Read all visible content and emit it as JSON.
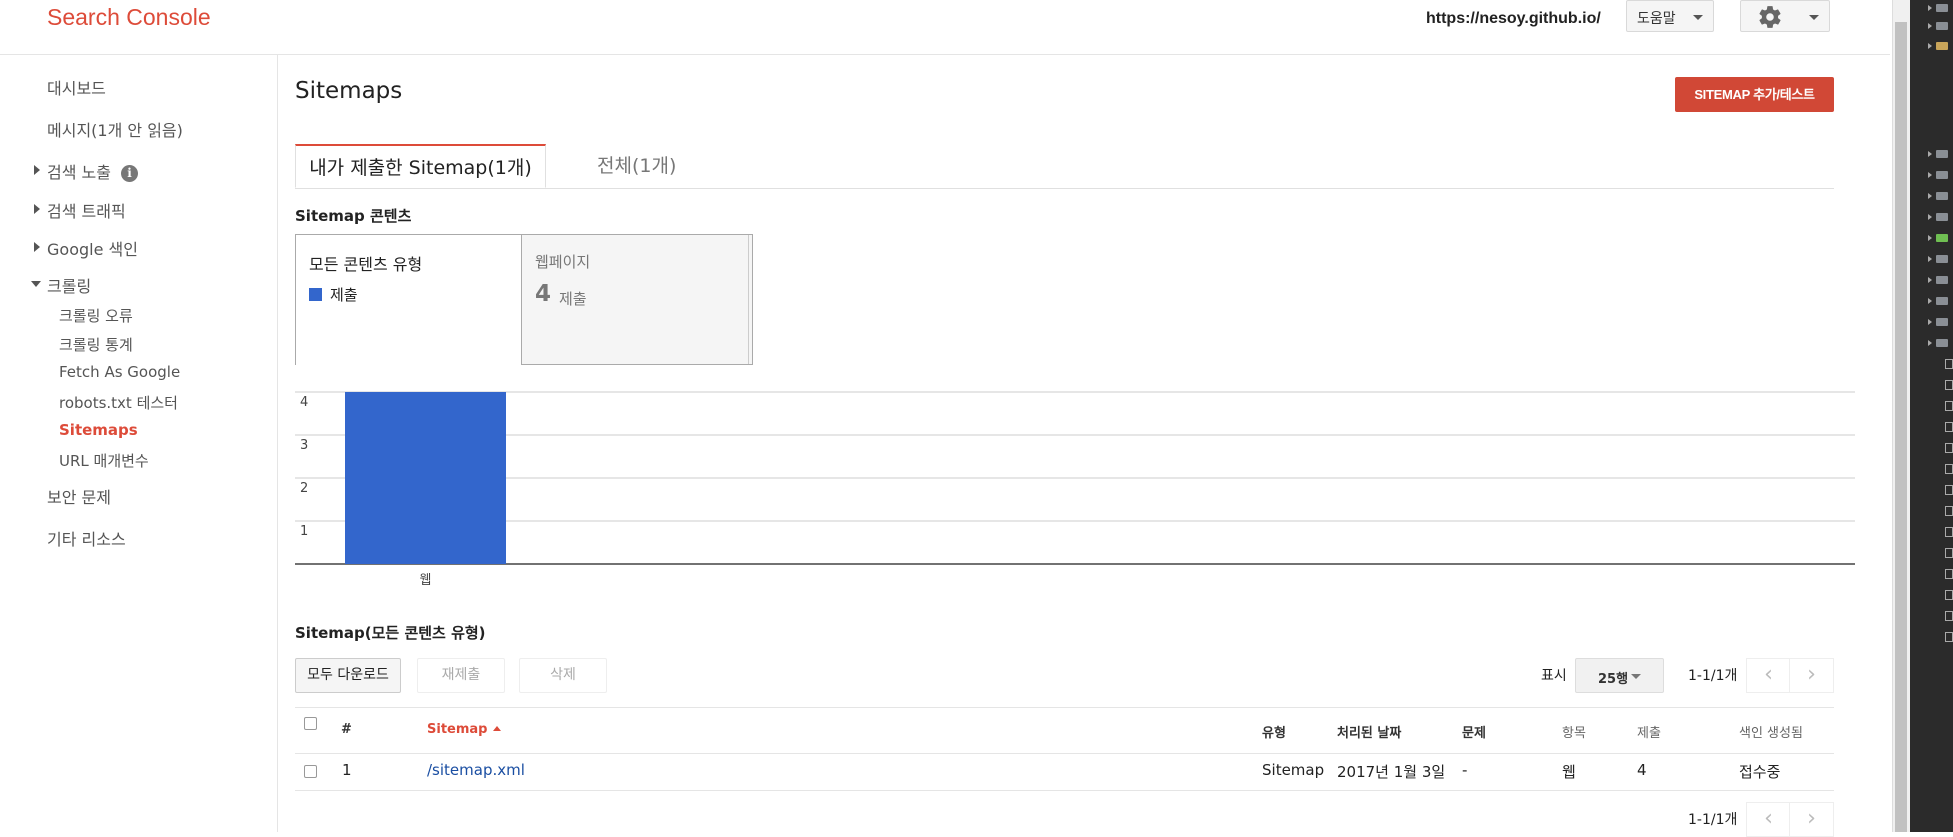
{
  "header": {
    "logo": "Search Console",
    "site_url": "https://nesoy.github.io/",
    "help_label": "도움말",
    "settings_icon": "gear-icon"
  },
  "sidebar": {
    "items": [
      {
        "label": "대시보드"
      },
      {
        "label": "메시지(1개 안 읽음)"
      },
      {
        "label": "검색 노출"
      },
      {
        "label": "검색 트래픽"
      },
      {
        "label": "Google 색인"
      },
      {
        "label": "크롤링"
      },
      {
        "label": "보안 문제"
      },
      {
        "label": "기타 리소스"
      }
    ],
    "info_icon_glyph": "i",
    "crawl_subitems": [
      {
        "label": "크롤링 오류"
      },
      {
        "label": "크롤링 통계"
      },
      {
        "label": "Fetch As Google"
      },
      {
        "label": "robots.txt 테스터"
      },
      {
        "label": "Sitemaps"
      },
      {
        "label": "URL 매개변수"
      }
    ]
  },
  "main": {
    "title": "Sitemaps",
    "add_button": "SITEMAP 추가/테스트",
    "tabs": [
      {
        "label": "내가 제출한 Sitemap(1개)"
      },
      {
        "label": "전체(1개)"
      }
    ],
    "content_label": "Sitemap 콘텐츠",
    "cards": {
      "all_types": {
        "title": "모든 콘텐츠 유형",
        "legend": "제출"
      },
      "webpages": {
        "title": "웹페이지",
        "count": "4",
        "count_label": "제출"
      }
    },
    "list_label": "Sitemap(모든 콘텐츠 유형)",
    "toolbar": {
      "download_all": "모두 다운로드",
      "resubmit": "재제출",
      "delete": "삭제",
      "show_label": "표시",
      "rows_per_page": "25행",
      "range": "1-1/1개",
      "prev_glyph": "‹",
      "next_glyph": "›"
    },
    "table": {
      "headers": {
        "num": "#",
        "sitemap": "Sitemap",
        "type": "유형",
        "processed": "처리된 날짜",
        "issues": "문제",
        "items": "항목",
        "submitted": "제출",
        "indexed": "색인 생성됨"
      },
      "rows": [
        {
          "num": "1",
          "sitemap": "/sitemap.xml",
          "type": "Sitemap",
          "processed": "2017년 1월 3일",
          "issues": "-",
          "items": "웹",
          "submitted": "4",
          "indexed": "접수중"
        }
      ]
    },
    "bottom_range": "1-1/1개"
  },
  "chart_data": {
    "type": "bar",
    "categories": [
      "웹"
    ],
    "series": [
      {
        "name": "제출",
        "values": [
          4
        ]
      }
    ],
    "y_ticks": [
      1,
      2,
      3,
      4
    ],
    "ylim": [
      0,
      4
    ],
    "bar_color": "#3366cc",
    "grid": true
  },
  "colors": {
    "brand_red": "#dd4b39",
    "button_red": "#d14836",
    "link_blue": "#1a4ea2",
    "bar_blue": "#3366cc"
  }
}
